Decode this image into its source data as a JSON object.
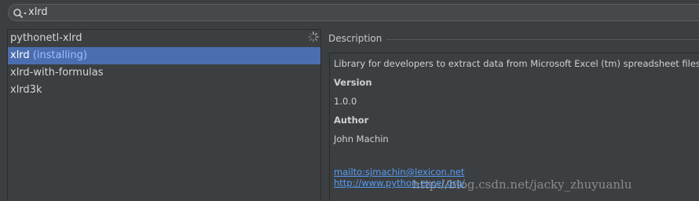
{
  "search": {
    "query": "xlrd"
  },
  "packages": {
    "items": [
      {
        "name": "pythonetl-xlrd",
        "status": ""
      },
      {
        "name": "xlrd",
        "status": "(installing)"
      },
      {
        "name": "xlrd-with-formulas",
        "status": ""
      },
      {
        "name": "xlrd3k",
        "status": ""
      }
    ]
  },
  "description": {
    "header": "Description",
    "summary": "Library for developers to extract data from Microsoft Excel (tm) spreadsheet files",
    "version_label": "Version",
    "version_value": "1.0.0",
    "author_label": "Author",
    "author_value": "John Machin",
    "email_link": "mailto:sjmachin@lexicon.net",
    "homepage_link": "http://www.python-excel.org/"
  },
  "watermark": "http://blog.csdn.net/jacky_zhuyuanlu"
}
